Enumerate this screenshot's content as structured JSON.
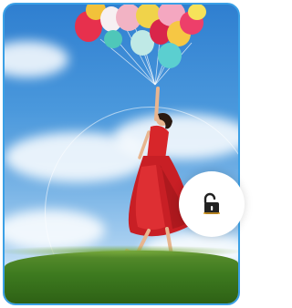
{
  "screen": {
    "type": "lock-screen",
    "wallpaper": "girl-with-balloons",
    "unlock_control": {
      "icon": "unlock-icon",
      "accent_color": "#3aa0e6"
    }
  },
  "colors": {
    "frame_border": "#3aa0e6",
    "sky_top": "#2f7fd0",
    "grass": "#3d7a1f",
    "dress": "#d7262a"
  }
}
